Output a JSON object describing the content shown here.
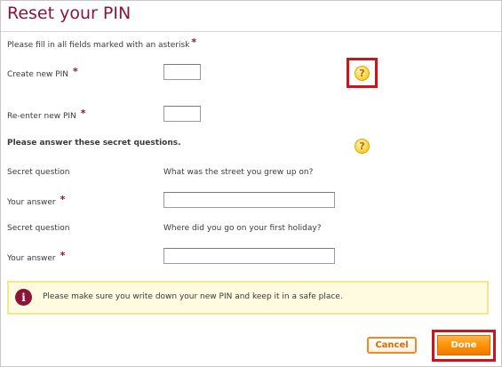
{
  "page": {
    "title": "Reset your PIN",
    "instructions": "Please fill in all fields marked with an asterisk",
    "required_marker": "*"
  },
  "pin": {
    "create_label": "Create new PIN",
    "reenter_label": "Re-enter new PIN",
    "create_value": "",
    "reenter_value": ""
  },
  "secret": {
    "heading": "Please answer these secret questions.",
    "question_label": "Secret question",
    "answer_label": "Your answer",
    "question_1": "What was the street you grew up on?",
    "question_2": "Where did you go on your first holiday?",
    "answer_1": "",
    "answer_2": ""
  },
  "help_glyph": "?",
  "notice": {
    "icon_glyph": "i",
    "text": "Please make sure you write down your new PIN and keep it in a safe place."
  },
  "buttons": {
    "cancel": "Cancel",
    "done": "Done"
  },
  "colors": {
    "title": "#8a1538",
    "accent_orange": "#ff9000",
    "highlight_red": "#d0121b",
    "notice_bg": "#fffbe0"
  },
  "icons": {
    "help": "help-question-icon",
    "info": "info-icon"
  }
}
